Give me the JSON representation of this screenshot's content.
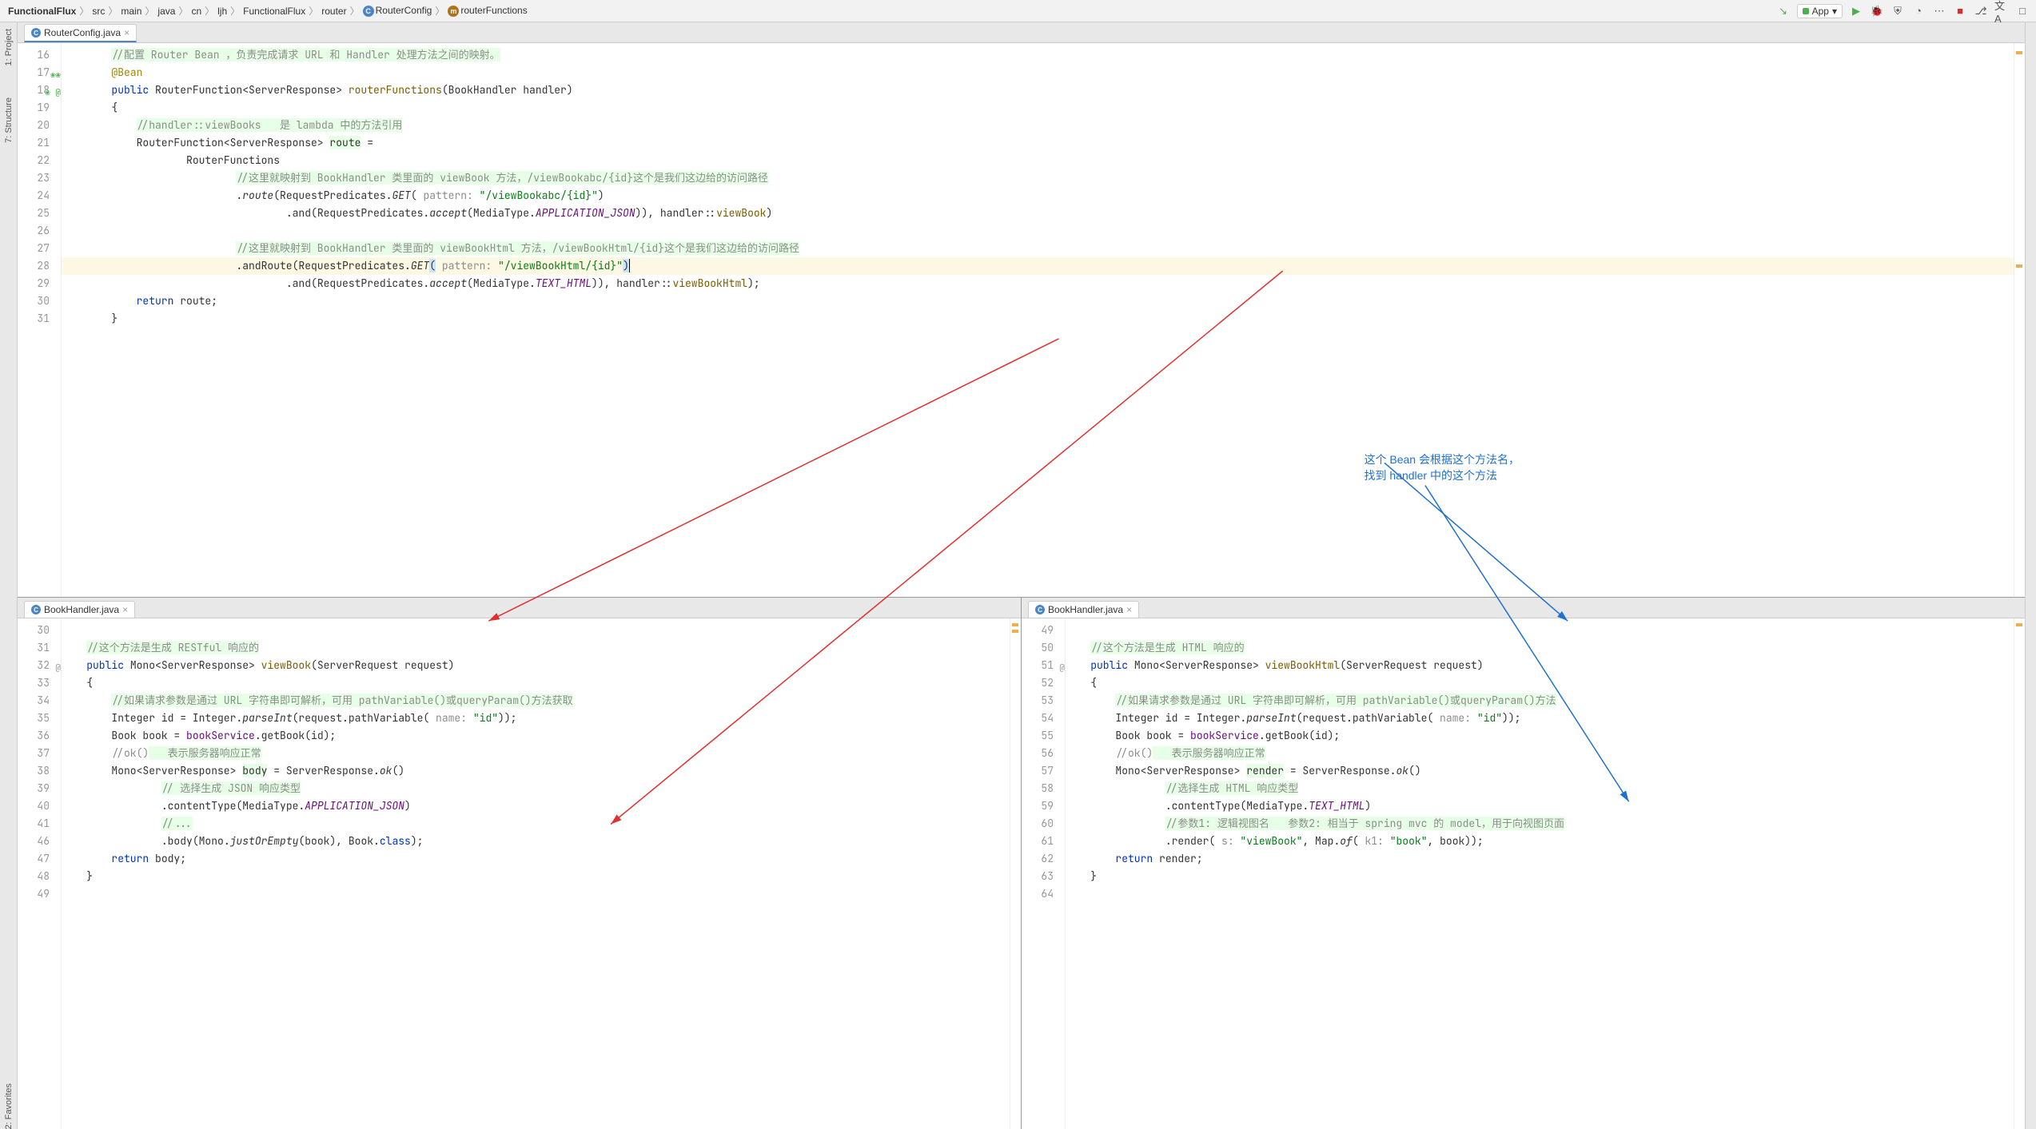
{
  "breadcrumbs": {
    "root": "FunctionalFlux",
    "p1": "src",
    "p2": "main",
    "p3": "java",
    "p4": "cn",
    "p5": "ljh",
    "p6": "FunctionalFlux",
    "p7": "router",
    "p8": "RouterConfig",
    "p9": "routerFunctions"
  },
  "run_config": "App",
  "tabs": {
    "top": "RouterConfig.java",
    "bl": "BookHandler.java",
    "br": "BookHandler.java"
  },
  "rail": {
    "project": "1: Project",
    "structure": "7: Structure",
    "fav": "2: Favorites"
  },
  "top_editor": {
    "lines": [
      "16",
      "17",
      "18",
      "19",
      "20",
      "21",
      "22",
      "23",
      "24",
      "25",
      "26",
      "27",
      "28",
      "29",
      "30",
      "31"
    ],
    "l16": "//配置 Router Bean ，负责完成请求 URL 和 Handler 处理方法之间的映射。",
    "l17": "@Bean",
    "l18_kw": "public",
    "l18_ret": " RouterFunction<ServerResponse> ",
    "l18_name": "routerFunctions",
    "l18_params": "(BookHandler handler)",
    "l19": "{",
    "l20": "//handler::viewBooks   是 lambda 中的方法引用",
    "l21a": "RouterFunction<ServerResponse> ",
    "l21b": "route",
    "l21c": " =",
    "l22": "RouterFunctions",
    "l23": "//这里就映射到 BookHandler 类里面的 viewBook 方法，/viewBookabc/{id}这个是我们这边给的访问路径",
    "l24a": ".",
    "l24b": "route",
    "l24c": "(RequestPredicates.",
    "l24d": "GET",
    "l24e": "(",
    "l24p": " pattern: ",
    "l24f": "\"/viewBookabc/{id}\"",
    "l24g": ")",
    "l25a": ".and(RequestPredicates.",
    "l25b": "accept",
    "l25c": "(MediaType.",
    "l25d": "APPLICATION_JSON",
    "l25e": ")), handler::",
    "l25f": "viewBook",
    "l25g": ")",
    "l27": "//这里就映射到 BookHandler 类里面的 viewBookHtml 方法，/viewBookHtml/{id}这个是我们这边给的访问路径",
    "l28a": ".andRoute(RequestPredicates.",
    "l28b": "GET",
    "l28c": "(",
    "l28p": " pattern: ",
    "l28d": "\"/viewBookHtml/{id}\"",
    "l28e": ")",
    "l29a": ".and(RequestPredicates.",
    "l29b": "accept",
    "l29c": "(MediaType.",
    "l29d": "TEXT_HTML",
    "l29e": ")), handler::",
    "l29f": "viewBookHtml",
    "l29g": ");",
    "l30a": "return",
    "l30b": " route;",
    "l31": "}"
  },
  "bl_editor": {
    "lines": [
      "30",
      "31",
      "32",
      "33",
      "34",
      "35",
      "36",
      "37",
      "38",
      "39",
      "40",
      "41",
      "46",
      "47",
      "48",
      "49"
    ],
    "l31": "//这个方法是生成 RESTful 响应的",
    "l32a": "public",
    "l32b": " Mono<ServerResponse> ",
    "l32c": "viewBook",
    "l32d": "(ServerRequest request)",
    "l33": "{",
    "l34": "//如果请求参数是通过 URL 字符串即可解析，可用 pathVariable()或queryParam()方法获取",
    "l35a": "Integer id = Integer.",
    "l35b": "parseInt",
    "l35c": "(request.pathVariable(",
    "l35p": " name: ",
    "l35d": "\"id\"",
    "l35e": "));",
    "l36a": "Book book = ",
    "l36b": "bookService",
    "l36c": ".getBook(id);",
    "l37a": "//ok()",
    "l37b": "   表示服务器响应正常",
    "l38a": "Mono<ServerResponse> ",
    "l38b": "body",
    "l38c": " = ServerResponse.",
    "l38d": "ok",
    "l38e": "()",
    "l39": "// 选择生成 JSON 响应类型",
    "l40a": ".contentType(MediaType.",
    "l40b": "APPLICATION_JSON",
    "l40c": ")",
    "l41": "//...",
    "l46a": ".body(Mono.",
    "l46b": "justOrEmpty",
    "l46c": "(book), Book.",
    "l46d": "class",
    "l46e": ");",
    "l47a": "return",
    "l47b": " body;",
    "l48": "}"
  },
  "br_editor": {
    "lines": [
      "49",
      "50",
      "51",
      "52",
      "53",
      "54",
      "55",
      "56",
      "57",
      "58",
      "59",
      "60",
      "61",
      "62",
      "63",
      "64"
    ],
    "l50": "//这个方法是生成 HTML 响应的",
    "l51a": "public",
    "l51b": " Mono<ServerResponse> ",
    "l51c": "viewBookHtml",
    "l51d": "(ServerRequest request)",
    "l52": "{",
    "l53": "//如果请求参数是通过 URL 字符串即可解析，可用 pathVariable()或queryParam()方法",
    "l54a": "Integer id = Integer.",
    "l54b": "parseInt",
    "l54c": "(request.pathVariable(",
    "l54p": " name: ",
    "l54d": "\"id\"",
    "l54e": "));",
    "l55a": "Book book = ",
    "l55b": "bookService",
    "l55c": ".getBook(id);",
    "l56a": "//ok()",
    "l56b": "   表示服务器响应正常",
    "l57a": "Mono<ServerResponse> ",
    "l57b": "render",
    "l57c": " = ServerResponse.",
    "l57d": "ok",
    "l57e": "()",
    "l58": "//选择生成 HTML 响应类型",
    "l59a": ".contentType(MediaType.",
    "l59b": "TEXT_HTML",
    "l59c": ")",
    "l60": "//参数1: 逻辑视图名   参数2: 相当于 spring mvc 的 model，用于向视图页面",
    "l61a": ".render(",
    "l61s": " s: ",
    "l61b": "\"viewBook\"",
    "l61c": ", Map.",
    "l61d": "of",
    "l61e": "(",
    "l61k": " k1: ",
    "l61f": "\"book\"",
    "l61g": ", book));",
    "l62a": "return",
    "l62b": " render;",
    "l63": "}"
  },
  "annotation": {
    "line1": "这个 Bean 会根据这个方法名，",
    "line2": "找到 handler 中的这个方法"
  }
}
